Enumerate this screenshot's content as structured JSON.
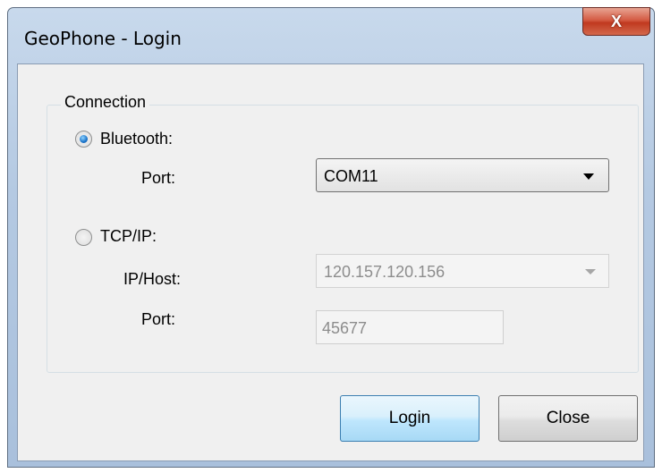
{
  "window": {
    "title": "GeoPhone - Login",
    "close_glyph": "X"
  },
  "connection": {
    "group_label": "Connection",
    "bluetooth": {
      "label": "Bluetooth:",
      "selected": true,
      "port_label": "Port:",
      "port_value": "COM11"
    },
    "tcpip": {
      "label": "TCP/IP:",
      "selected": false,
      "host_label": "IP/Host:",
      "host_value": "120.157.120.156",
      "port_label": "Port:",
      "port_value": "45677"
    }
  },
  "buttons": {
    "login": "Login",
    "close": "Close"
  },
  "colors": {
    "title_bar": "#b4c9e2",
    "close_button": "#c0391f",
    "radio_checked": "#1a73c9",
    "primary_button": "#bee6fd"
  },
  "icons": {
    "close": "close-icon",
    "dropdown": "chevron-down-icon"
  }
}
